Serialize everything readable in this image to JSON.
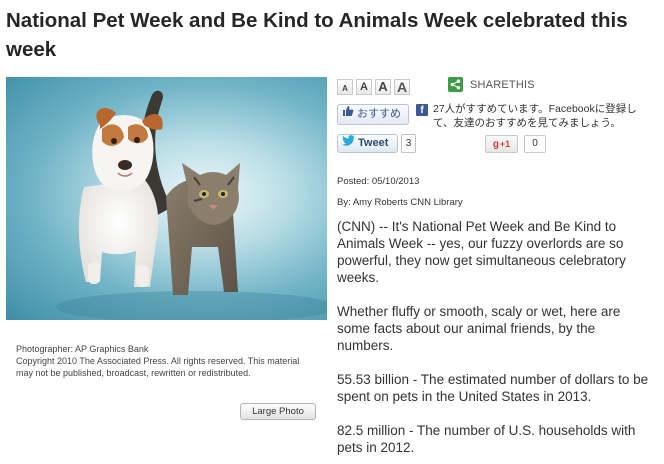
{
  "article": {
    "title": "National Pet Week and Be Kind to Animals Week celebrated this week",
    "photo": {
      "credit_line": "Photographer: AP Graphics Bank",
      "copyright": "Copyright 2010 The Associated Press. All rights reserved. This material may not be published, broadcast, rewritten or redistributed.",
      "large_photo_label": "Large Photo"
    },
    "posted": "Posted: 05/10/2013",
    "byline": "By: Amy Roberts CNN Library",
    "paragraphs": [
      "(CNN) -- It's National Pet Week and Be Kind to Animals Week -- yes, our fuzzy overlords are so powerful, they now get simultaneous celebratory weeks.",
      "Whether fluffy or smooth, scaly or wet, here are some facts about our animal friends, by the numbers.",
      "55.53 billion - The estimated number of dollars to be spent on pets in the United States in 2013.",
      "82.5 million - The number of U.S. households with pets in 2012."
    ]
  },
  "tools": {
    "font_sizes": [
      "A",
      "A",
      "A",
      "A"
    ],
    "share_label": "SHARETHIS",
    "facebook": {
      "like_label": "おすすめ",
      "icon_letter": "f",
      "social_text": "27人がすすめています。Facebookに登録して、友達のおすすめを見てみましょう。"
    },
    "twitter": {
      "label": "Tweet",
      "count": "3"
    },
    "google_plus": {
      "g": "g",
      "label": "+1",
      "count": "0"
    }
  },
  "colors": {
    "share_green": "#3d9b42",
    "facebook_blue": "#3b5998",
    "gplus_red": "#d73d32"
  },
  "icons": [
    "share-icon",
    "thumbs-up-icon",
    "facebook-icon",
    "twitter-bird-icon",
    "google-plus-icon"
  ]
}
